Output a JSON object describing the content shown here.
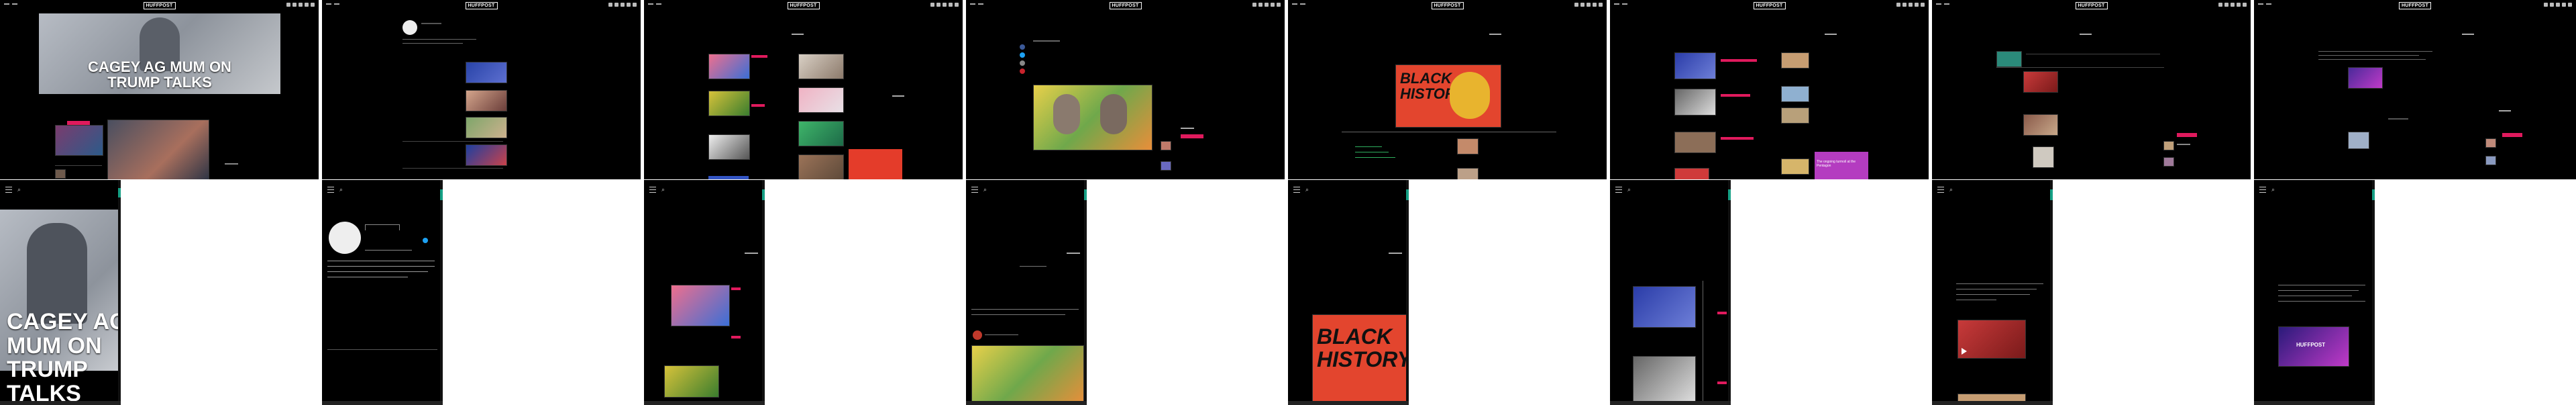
{
  "brand": {
    "logo": "HUFFPOST",
    "accent": "#e01a5d",
    "teal": "#16a085"
  },
  "panel1": {
    "headline": "CAGEY AG MUM ON TRUMP TALKS"
  },
  "mobile1": {
    "headline": "CAGEY AG MUM ON TRUMP TALKS"
  },
  "panel6": {
    "promo": "The ongoing turmoil at the Pentagon"
  },
  "panel5": {
    "art": "BLACK HISTORY"
  },
  "mobile5": {
    "art": "BLACK HISTORY"
  }
}
